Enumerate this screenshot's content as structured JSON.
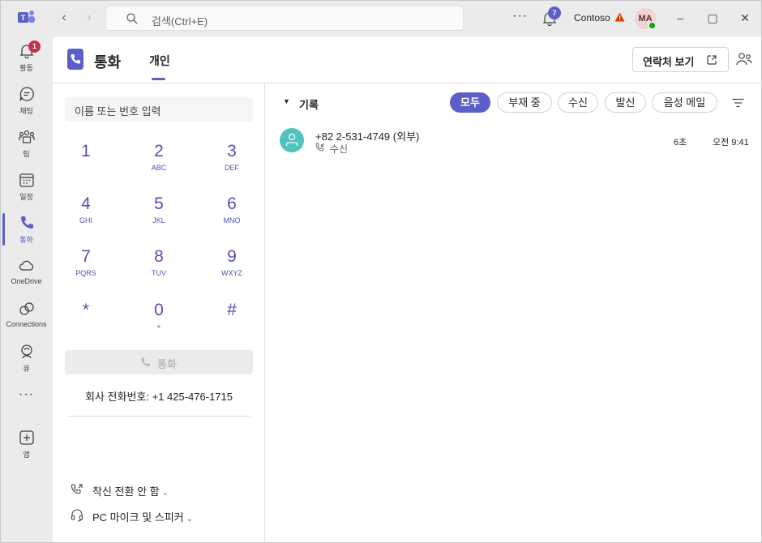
{
  "titlebar": {
    "search_placeholder": "검색(Ctrl+E)",
    "notification_count": "7",
    "org_name": "Contoso",
    "avatar_initials": "MA"
  },
  "rail": {
    "items": [
      {
        "label": "활동",
        "icon": "bell-icon",
        "badge": "1"
      },
      {
        "label": "채팅",
        "icon": "chat-icon"
      },
      {
        "label": "팀",
        "icon": "teams-icon"
      },
      {
        "label": "일정",
        "icon": "calendar-icon"
      },
      {
        "label": "통화",
        "icon": "phone-icon",
        "active": true
      },
      {
        "label": "OneDrive",
        "icon": "cloud-icon"
      },
      {
        "label": "Connections",
        "icon": "connections-icon"
      },
      {
        "label": "큐",
        "icon": "queue-icon"
      },
      {
        "label": "앱",
        "icon": "add-app-icon"
      }
    ]
  },
  "header": {
    "title": "통화",
    "tab": "개인",
    "contacts_button": "연락처 보기"
  },
  "dialpad": {
    "input_placeholder": "이름 또는 번호 입력",
    "keys": [
      {
        "digit": "1",
        "letters": ""
      },
      {
        "digit": "2",
        "letters": "ABC"
      },
      {
        "digit": "3",
        "letters": "DEF"
      },
      {
        "digit": "4",
        "letters": "GHI"
      },
      {
        "digit": "5",
        "letters": "JKL"
      },
      {
        "digit": "6",
        "letters": "MNO"
      },
      {
        "digit": "7",
        "letters": "PQRS"
      },
      {
        "digit": "8",
        "letters": "TUV"
      },
      {
        "digit": "9",
        "letters": "WXYZ"
      },
      {
        "digit": "*",
        "letters": ""
      },
      {
        "digit": "0",
        "letters": "+"
      },
      {
        "digit": "#",
        "letters": ""
      }
    ],
    "call_button": "통화",
    "work_number": "회사 전화번호: +1 425-476-1715",
    "forwarding_label": "착신 전환 안 함",
    "device_label": "PC 마이크 및 스피커"
  },
  "history": {
    "title": "기록",
    "filters": [
      "모두",
      "부재 중",
      "수신",
      "발신",
      "음성 메일"
    ],
    "active_filter": "모두",
    "calls": [
      {
        "number": "+82 2-531-4749 (외부)",
        "type": "수신",
        "duration": "6초",
        "time": "오전 9:41"
      }
    ]
  },
  "colors": {
    "accent": "#5b5fc7",
    "avatar_teal": "#4fc3bd",
    "status_green": "#13a10e",
    "badge_red": "#c4314b"
  }
}
